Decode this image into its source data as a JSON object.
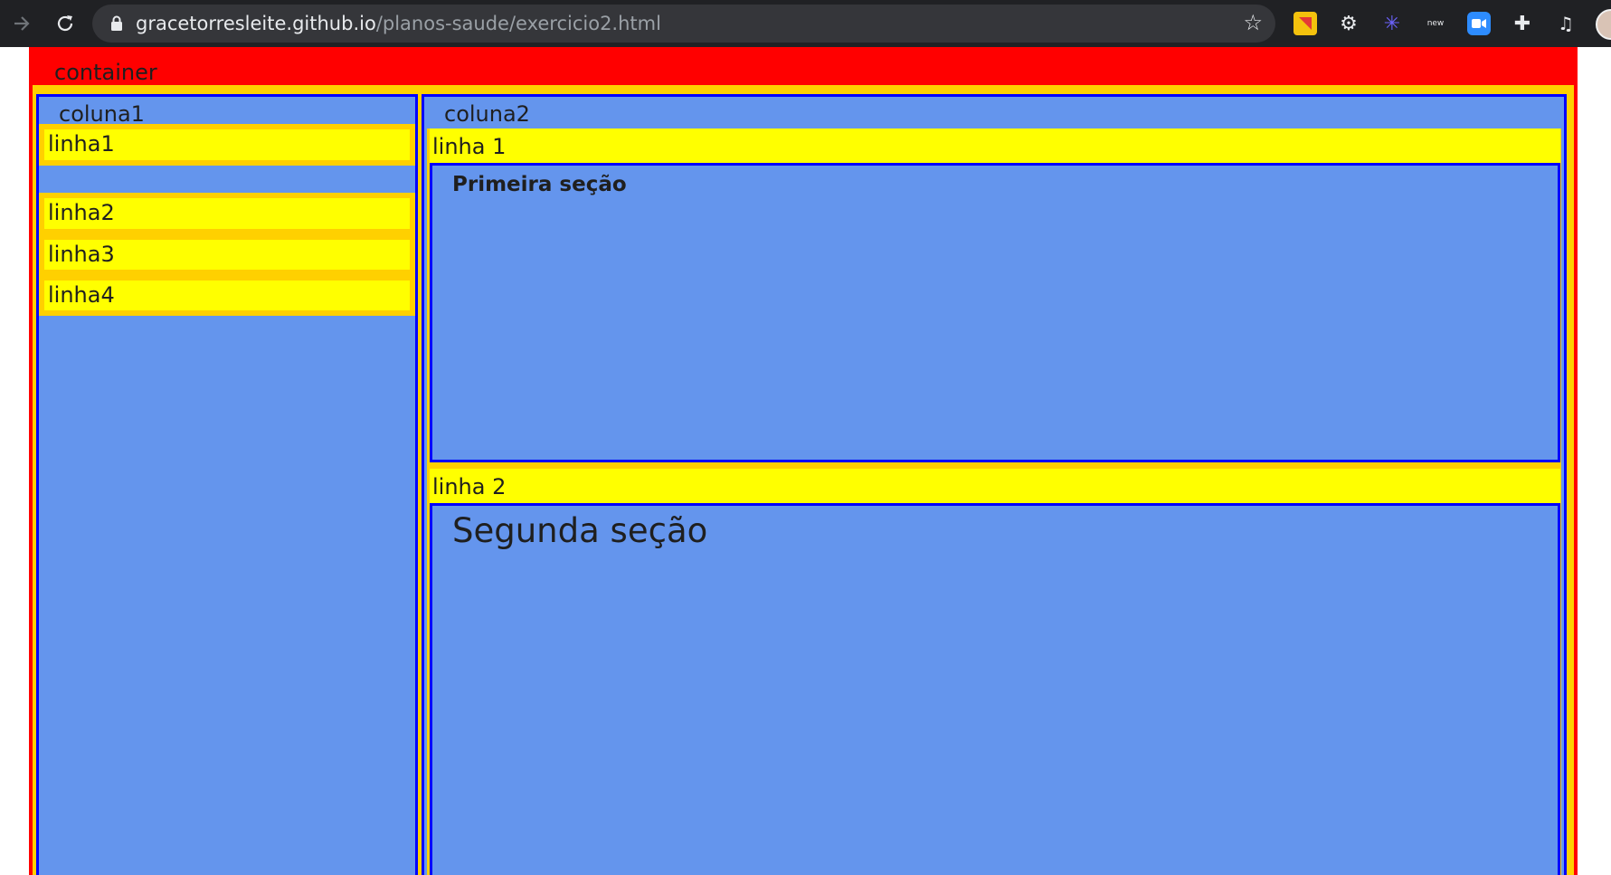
{
  "browser": {
    "url_host": "gracetorresleite.github.io",
    "url_path": "/planos-saude/exercicio2.html",
    "icons": [
      "forward-icon",
      "reload-icon",
      "lock-icon",
      "star-icon",
      "extension-icons",
      "puzzle-icon",
      "media-icon",
      "avatar"
    ]
  },
  "page": {
    "container_label": "container",
    "coluna1": {
      "label": "coluna1",
      "rows": [
        "linha1",
        "linha2",
        "linha3",
        "linha4"
      ]
    },
    "coluna2": {
      "label": "coluna2",
      "linha1_label": "linha 1",
      "section1_title": "Primeira seção",
      "linha2_label": "linha 2",
      "section2_title": "Segunda seção"
    }
  },
  "colors": {
    "container": "#ff0000",
    "gap": "#ffd000",
    "row": "#ffff00",
    "column": "#6495ed",
    "border": "#0000ff"
  }
}
